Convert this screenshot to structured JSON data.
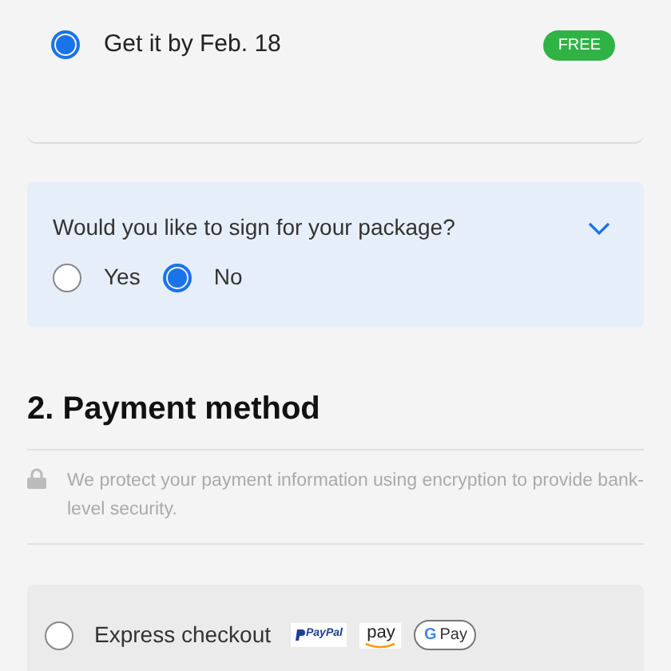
{
  "delivery_options": [
    {
      "label": "Get it by Feb. 18",
      "badge": "FREE",
      "selected": true
    }
  ],
  "signature": {
    "question": "Would you like to sign for your package?",
    "expanded": false,
    "options": [
      {
        "label": "Yes",
        "selected": false
      },
      {
        "label": "No",
        "selected": true
      }
    ]
  },
  "payment": {
    "heading": "2. Payment method",
    "security_note": "We protect your payment information using encryption to provide bank-level security.",
    "methods": [
      {
        "label": "Express checkout",
        "selected": false,
        "wallets": [
          {
            "kind": "paypal",
            "label": "PayPal"
          },
          {
            "kind": "amazon",
            "label": "pay"
          },
          {
            "kind": "google",
            "mark": "G",
            "label": "Pay"
          }
        ]
      }
    ]
  }
}
